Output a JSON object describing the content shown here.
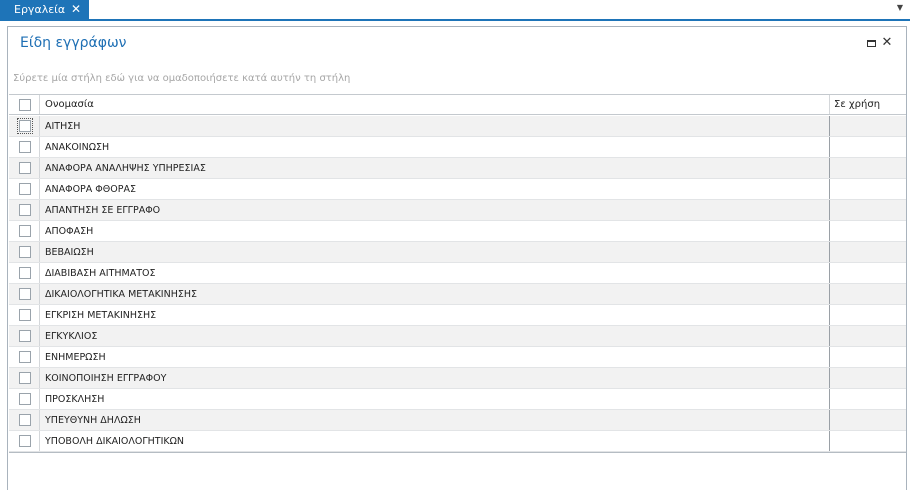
{
  "tabstrip": {
    "active_tab_label": "Εργαλεία",
    "close_glyph": "✕",
    "menu_glyph": "▼"
  },
  "panel": {
    "title": "Είδη εγγράφων",
    "close_glyph": "✕"
  },
  "grid": {
    "group_hint": "Σύρετε μία στήλη εδώ για να ομαδοποιήσετε κατά αυτήν τη στήλη",
    "columns": {
      "name": "Ονομασία",
      "in_use": "Σε χρήση"
    },
    "rows": [
      {
        "name": "ΑΙΤΗΣΗ",
        "in_use": ""
      },
      {
        "name": "ΑΝΑΚΟΙΝΩΣΗ",
        "in_use": ""
      },
      {
        "name": "ΑΝΑΦΟΡΑ ΑΝΑΛΗΨΗΣ ΥΠΗΡΕΣΙΑΣ",
        "in_use": ""
      },
      {
        "name": "ΑΝΑΦΟΡΑ ΦΘΟΡΑΣ",
        "in_use": ""
      },
      {
        "name": "ΑΠΑΝΤΗΣΗ ΣΕ ΕΓΓΡΑΦΟ",
        "in_use": ""
      },
      {
        "name": "ΑΠΟΦΑΣΗ",
        "in_use": ""
      },
      {
        "name": "ΒΕΒΑΙΩΣΗ",
        "in_use": ""
      },
      {
        "name": "ΔΙΑΒΙΒΑΣΗ ΑΙΤΗΜΑΤΟΣ",
        "in_use": ""
      },
      {
        "name": "ΔΙΚΑΙΟΛΟΓΗΤΙΚΑ ΜΕΤΑΚΙΝΗΣΗΣ",
        "in_use": ""
      },
      {
        "name": "ΕΓΚΡΙΣΗ ΜΕΤΑΚΙΝΗΣΗΣ",
        "in_use": ""
      },
      {
        "name": "ΕΓΚΥΚΛΙΟΣ",
        "in_use": ""
      },
      {
        "name": "ΕΝΗΜΕΡΩΣΗ",
        "in_use": ""
      },
      {
        "name": "ΚΟΙΝΟΠΟΙΗΣΗ ΕΓΓΡΑΦΟΥ",
        "in_use": ""
      },
      {
        "name": "ΠΡΟΣΚΛΗΣΗ",
        "in_use": ""
      },
      {
        "name": "ΥΠΕΥΘΥΝΗ ΔΗΛΩΣΗ",
        "in_use": ""
      },
      {
        "name": "ΥΠΟΒΟΛΗ ΔΙΚΑΙΟΛΟΓΗΤΙΚΩΝ",
        "in_use": ""
      }
    ]
  },
  "colors": {
    "accent": "#1e74b8",
    "title": "#1e6fb4"
  }
}
